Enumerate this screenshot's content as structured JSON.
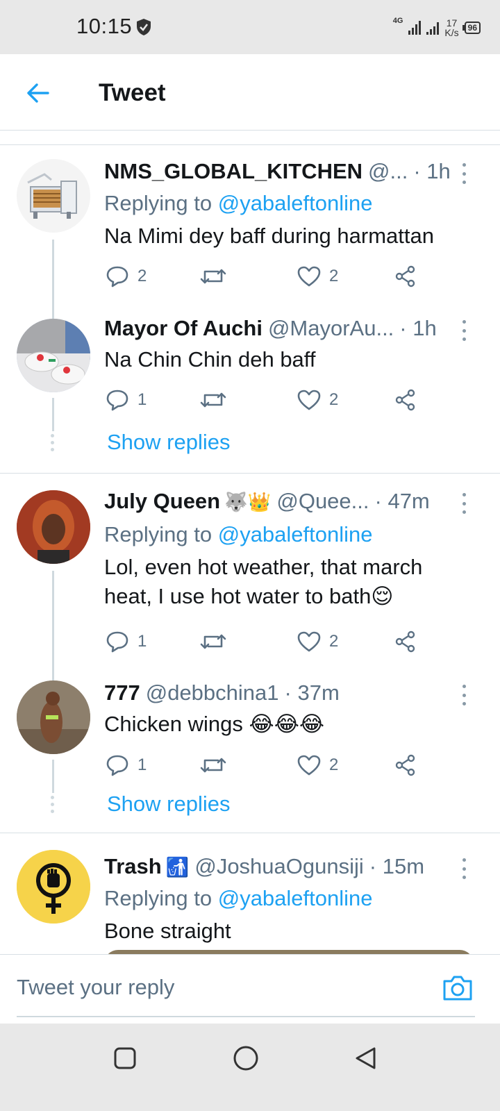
{
  "status_bar": {
    "time": "10:15",
    "network": "4G",
    "speed_value": "17",
    "speed_unit": "K/s",
    "battery": "96"
  },
  "header": {
    "title": "Tweet"
  },
  "colors": {
    "accent": "#1da1f2",
    "secondary_text": "#5b7083",
    "primary_text": "#14171a",
    "divider": "#d8dfe4"
  },
  "tweets": [
    {
      "name": "NMS_GLOBAL_KITCHEN",
      "handle": "@...",
      "time": "· 1h",
      "replying_prefix": "Replying to ",
      "replying_handle": "@yabaleftonline",
      "text": "Na Mimi dey baff during harmattan",
      "replies": "2",
      "likes": "2"
    },
    {
      "name": "Mayor Of Auchi",
      "handle": "@MayorAu...",
      "time": "· 1h",
      "text": "Na Chin Chin deh baff",
      "replies": "1",
      "likes": "2",
      "show_replies": "Show replies"
    },
    {
      "name": "July Queen",
      "name_emojis": "🐺👑",
      "handle": "@Quee...",
      "time": "· 47m",
      "replying_prefix": "Replying to ",
      "replying_handle": "@yabaleftonline",
      "text": "Lol, even hot weather, that march heat, I use hot water to bath😌",
      "replies": "1",
      "likes": "2"
    },
    {
      "name": "777",
      "handle": "@debbchina1",
      "time": "· 37m",
      "text": "Chicken wings 😂😂😂",
      "replies": "1",
      "likes": "2",
      "show_replies": "Show replies"
    },
    {
      "name": "Trash",
      "name_emojis": "🚮",
      "handle": "@JoshuaOgunsiji",
      "time": "· 15m",
      "replying_prefix": "Replying to ",
      "replying_handle": "@yabaleftonline",
      "text": "Bone straight"
    }
  ],
  "composer": {
    "placeholder": "Tweet your reply"
  },
  "icons": {
    "back": "arrow-left-icon",
    "reply": "speech-bubble-icon",
    "retweet": "retweet-icon",
    "like": "heart-icon",
    "share": "share-icon",
    "more": "more-vertical-icon",
    "camera": "camera-icon"
  }
}
